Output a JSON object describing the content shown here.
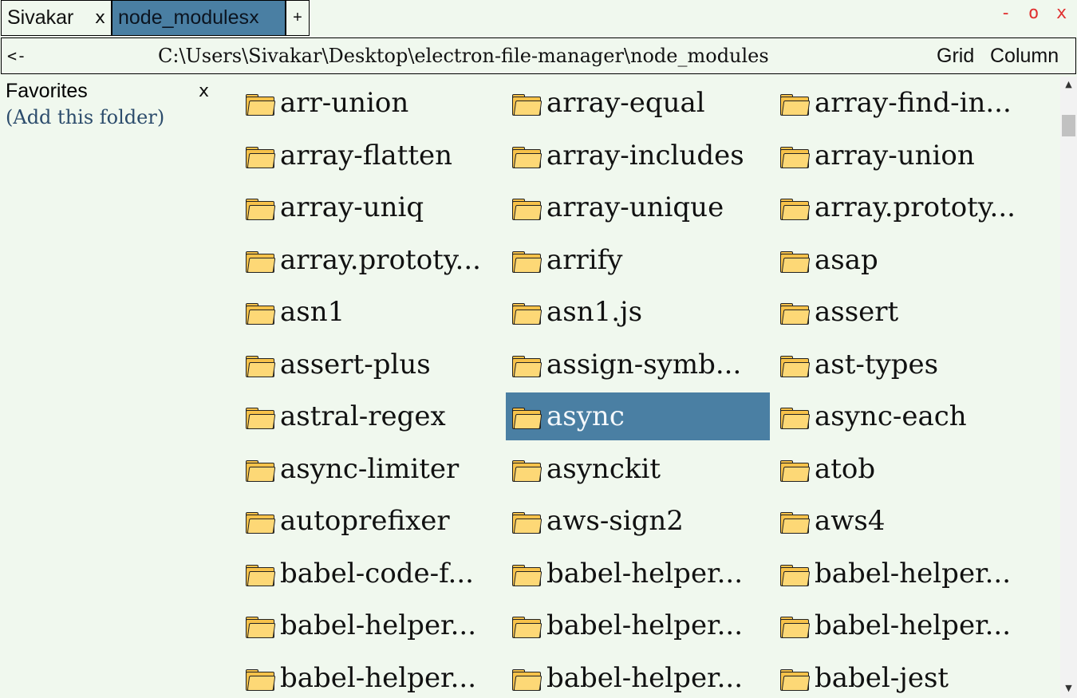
{
  "tabs": [
    {
      "label": "Sivakar",
      "close": "x"
    },
    {
      "label": "node_modules",
      "close": "x",
      "active": true
    }
  ],
  "tab_add": "+",
  "window_controls": {
    "minimize": "-",
    "maximize": "o",
    "close": "x"
  },
  "address_bar": {
    "back": "<-",
    "path": "C:\\Users\\Sivakar\\Desktop\\electron-file-manager\\node_modules",
    "view_grid": "Grid",
    "view_column": "Column"
  },
  "sidebar": {
    "title": "Favorites",
    "close": "x",
    "add_folder": "(Add this folder)"
  },
  "items": [
    {
      "name": "arr-union"
    },
    {
      "name": "array-equal"
    },
    {
      "name": "array-find-in..."
    },
    {
      "name": "array-flatten"
    },
    {
      "name": "array-includes"
    },
    {
      "name": "array-union"
    },
    {
      "name": "array-uniq"
    },
    {
      "name": "array-unique"
    },
    {
      "name": "array.prototy..."
    },
    {
      "name": "array.prototy..."
    },
    {
      "name": "arrify"
    },
    {
      "name": "asap"
    },
    {
      "name": "asn1"
    },
    {
      "name": "asn1.js"
    },
    {
      "name": "assert"
    },
    {
      "name": "assert-plus"
    },
    {
      "name": "assign-symb..."
    },
    {
      "name": "ast-types"
    },
    {
      "name": "astral-regex"
    },
    {
      "name": "async",
      "selected": true
    },
    {
      "name": "async-each"
    },
    {
      "name": "async-limiter"
    },
    {
      "name": "asynckit"
    },
    {
      "name": "atob"
    },
    {
      "name": "autoprefixer"
    },
    {
      "name": "aws-sign2"
    },
    {
      "name": "aws4"
    },
    {
      "name": "babel-code-f..."
    },
    {
      "name": "babel-helper..."
    },
    {
      "name": "babel-helper..."
    },
    {
      "name": "babel-helper..."
    },
    {
      "name": "babel-helper..."
    },
    {
      "name": "babel-helper..."
    },
    {
      "name": "babel-helper..."
    },
    {
      "name": "babel-helper..."
    },
    {
      "name": "babel-jest"
    }
  ],
  "colors": {
    "background": "#f0f8ee",
    "selected": "#4a7fa3",
    "folder": "#f7c24a",
    "window_controls": "#e03030",
    "link": "#2c4c6c"
  },
  "scrollbar": {
    "up": "▲",
    "down": "▼"
  }
}
